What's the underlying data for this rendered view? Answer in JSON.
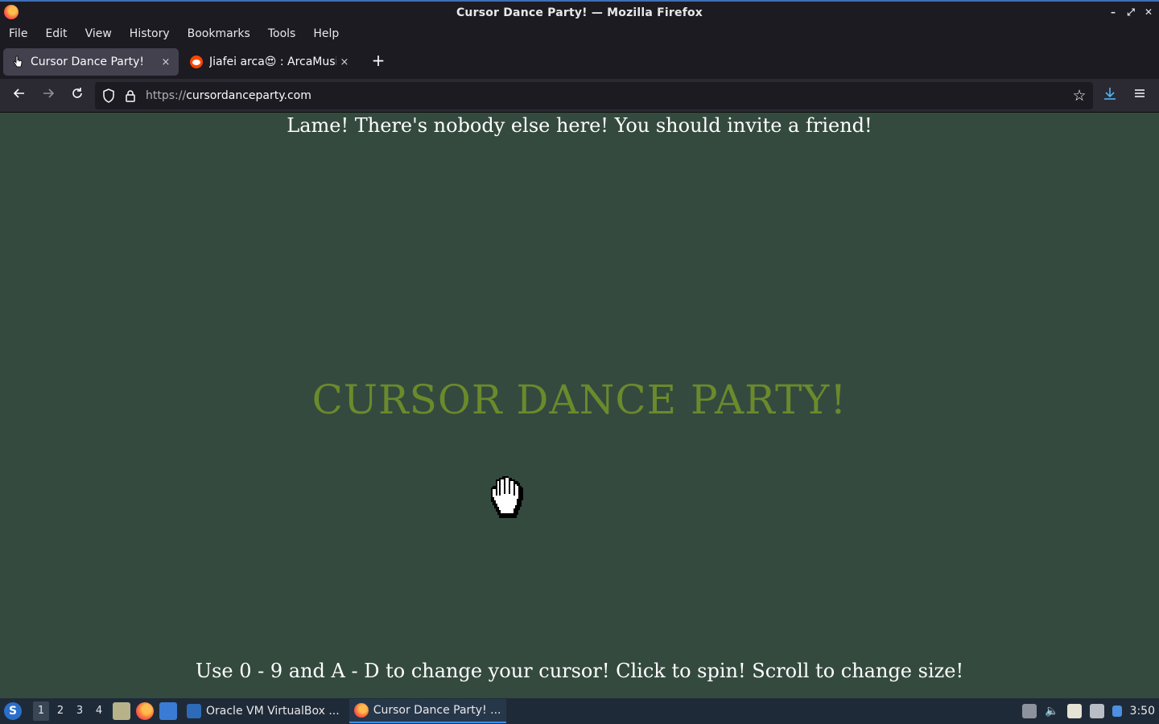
{
  "window": {
    "title": "Cursor Dance Party! — Mozilla Firefox",
    "controls": [
      "–",
      "⤢",
      "✕"
    ]
  },
  "menubar": {
    "items": [
      "File",
      "Edit",
      "View",
      "History",
      "Bookmarks",
      "Tools",
      "Help"
    ]
  },
  "tabs": [
    {
      "label": "Cursor Dance Party!",
      "active": true,
      "close": "×"
    },
    {
      "label": "Jiafei arca😍 : ArcaMusic",
      "active": false,
      "close": "×"
    }
  ],
  "new_tab_label": "+",
  "navbar": {
    "url_protocol": "https://",
    "url_host": "cursordanceparty.com"
  },
  "page": {
    "notice": "Lame! There's nobody else here! You should invite a friend!",
    "title": "CURSOR DANCE PARTY!",
    "instructions": "Use 0 - 9 and A - D to change your cursor! Click to spin! Scroll to change size!",
    "background_color": "#344a3f",
    "title_color": "#6b8a2b"
  },
  "taskbar": {
    "workspaces": [
      "1",
      "2",
      "3",
      "4"
    ],
    "tasks": [
      {
        "label": "Oracle VM VirtualBox ...",
        "active": false
      },
      {
        "label": "Cursor Dance Party! ...",
        "active": true
      }
    ],
    "clock": "3:50"
  }
}
